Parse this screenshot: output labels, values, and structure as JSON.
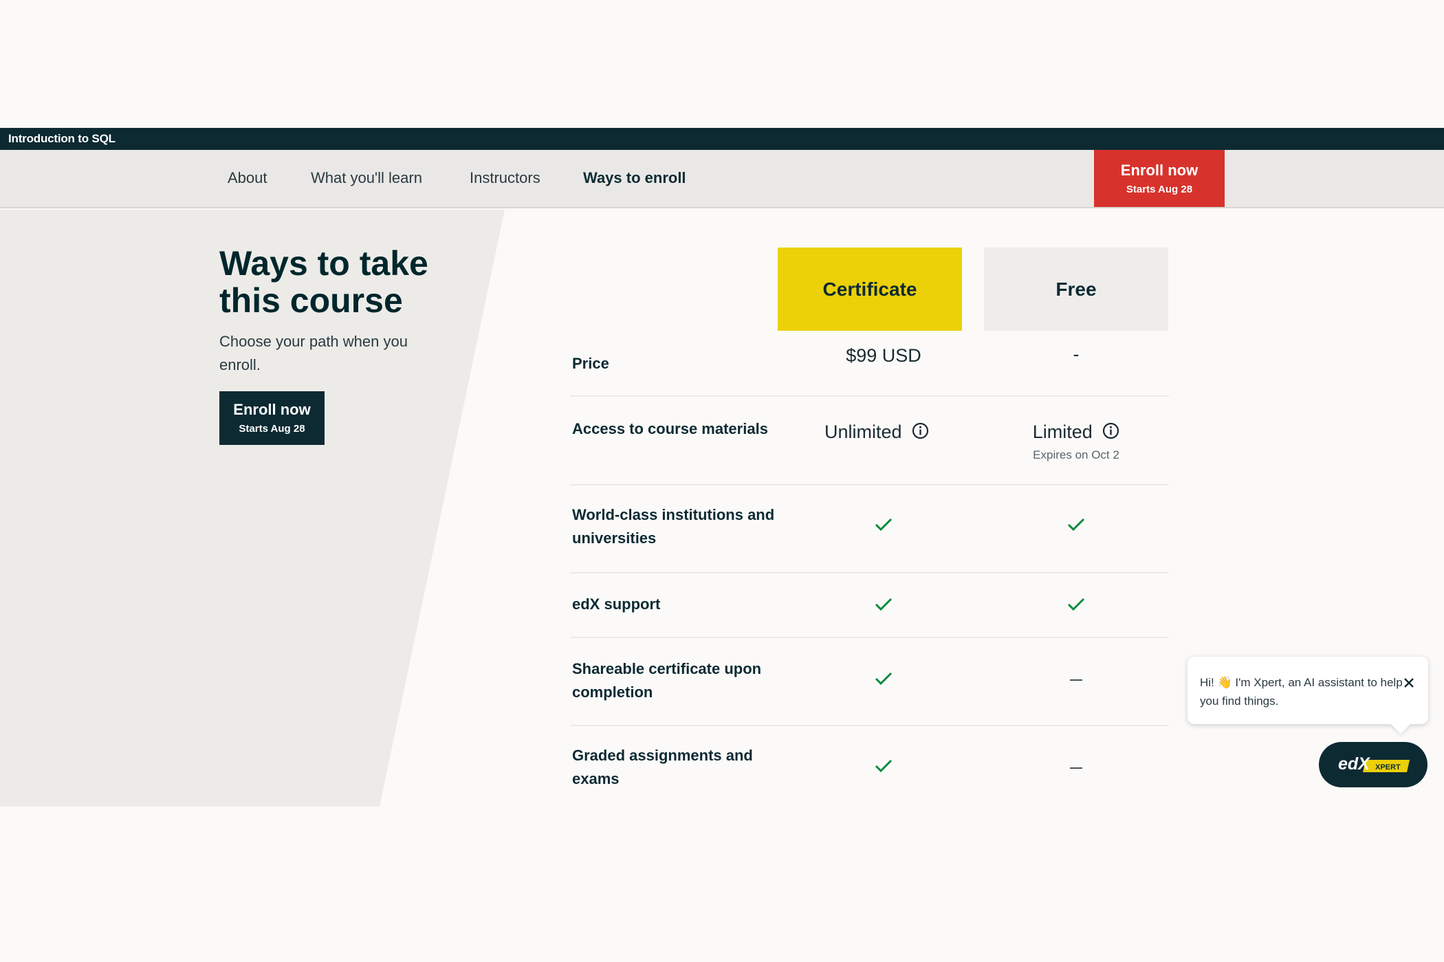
{
  "topbar": {
    "course_title": "Introduction to SQL"
  },
  "nav": {
    "items": [
      {
        "label": "About"
      },
      {
        "label": "What you'll learn"
      },
      {
        "label": "Instructors"
      },
      {
        "label": "Ways to enroll"
      }
    ],
    "active": "Ways to enroll",
    "enroll": {
      "label": "Enroll now",
      "sub": "Starts Aug 28"
    }
  },
  "intro": {
    "heading": "Ways to take this course",
    "subtext": "Choose your path when you enroll.",
    "enroll": {
      "label": "Enroll now",
      "sub": "Starts Aug 28"
    }
  },
  "table": {
    "columns": {
      "certificate": "Certificate",
      "free": "Free"
    },
    "rows": {
      "price": {
        "label": "Price",
        "certificate": "$99 USD",
        "free": "-"
      },
      "access": {
        "label": "Access to course materials",
        "certificate": "Unlimited",
        "free": "Limited",
        "free_note": "Expires on Oct 2"
      },
      "institutions": {
        "label": "World-class institutions and universities",
        "certificate": "check",
        "free": "check"
      },
      "support": {
        "label": "edX support",
        "certificate": "check",
        "free": "check"
      },
      "shareable": {
        "label": "Shareable certificate upon completion",
        "certificate": "check",
        "free": "dash"
      },
      "graded": {
        "label": "Graded assignments and exams",
        "certificate": "check",
        "free": "dash"
      }
    }
  },
  "chat": {
    "message": "Hi! 👋 I'm Xpert, an AI assistant to help you find things.",
    "logo_text": "edX",
    "logo_badge": "XPERT"
  },
  "colors": {
    "brand_dark": "#0d2a33",
    "enroll_red": "#d7332c",
    "certificate_yellow": "#ecd008",
    "check_green": "#0b8a3e"
  },
  "icons": [
    "info-icon",
    "check-icon",
    "dash-icon",
    "close-icon"
  ]
}
